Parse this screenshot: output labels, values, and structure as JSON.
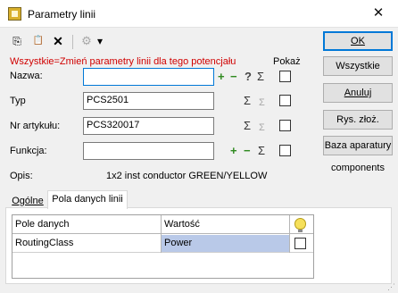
{
  "window": {
    "title": "Parametry linii",
    "close_glyph": "✕"
  },
  "toolbar": {
    "icons": [
      "copy-icon",
      "paste-icon",
      "delete-icon",
      "settings-icon",
      "dropdown-icon"
    ],
    "copy_glyph": "⎘",
    "paste_glyph": "📋",
    "delete_glyph": "✕",
    "settings_glyph": "⚙",
    "dropdown_glyph": "▾"
  },
  "note": "Wszystkie=Zmień parametry linii dla tego potencjału",
  "show_label": "Pokaż",
  "fields": {
    "nazwa": {
      "label": "Nazwa:",
      "value": ""
    },
    "typ": {
      "label": "Typ",
      "value": "PCS2501"
    },
    "nr": {
      "label": "Nr artykułu:",
      "value": "PCS320017"
    },
    "funkcja": {
      "label": "Funkcja:",
      "value": ""
    },
    "opis": {
      "label": "Opis:",
      "value": "1x2 inst conductor GREEN/YELLOW"
    }
  },
  "symbols": {
    "plus": "+",
    "minus": "−",
    "question": "?",
    "sigma": "Σ"
  },
  "buttons": {
    "ok": "OK",
    "all": "Wszystkie",
    "cancel": "Anuluj",
    "drawing": "Rys. złoż.",
    "database": "Baza aparatury",
    "components": "components"
  },
  "tabs": [
    "Ogólne",
    "Pola danych linii"
  ],
  "active_tab": "Pola danych linii",
  "table": {
    "headers": [
      "Pole danych",
      "Wartość"
    ],
    "rows": [
      {
        "field": "RoutingClass",
        "value": "Power",
        "checked": false
      }
    ]
  },
  "colors": {
    "note_red": "#d00000",
    "selection": "#b9c9e8",
    "green_plus": "#2f8a1f",
    "focus_blue": "#0078d7"
  }
}
